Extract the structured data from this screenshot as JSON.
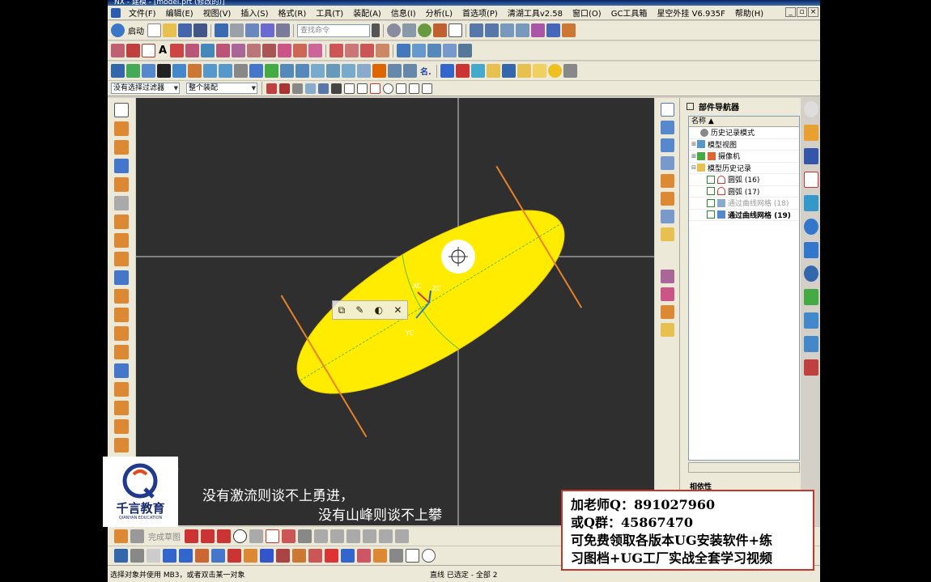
{
  "titlebar": {
    "text": "NX - 建模 - [model.prt (修改的)]"
  },
  "menu": {
    "items": [
      "文件(F)",
      "编辑(E)",
      "视图(V)",
      "插入(S)",
      "格式(R)",
      "工具(T)",
      "装配(A)",
      "信息(I)",
      "分析(L)",
      "首选项(P)",
      "清湖工具v2.58",
      "窗口(O)",
      "GC工具箱",
      "星空外挂 V6.935F",
      "帮助(H)"
    ]
  },
  "toolbar1": {
    "start_label": "启动",
    "search_placeholder": "查找命令"
  },
  "filter": {
    "selection_filter": "没有选择过滤器",
    "assembly_scope": "整个装配"
  },
  "navigator": {
    "title": "部件导航器",
    "column_header": "名称",
    "items": [
      {
        "label": "历史记录模式",
        "indent": 1
      },
      {
        "label": "模型视图",
        "indent": 0
      },
      {
        "label": "摄像机",
        "indent": 0
      },
      {
        "label": "模型历史记录",
        "indent": 0
      },
      {
        "label": "圆弧 (16)",
        "indent": 2
      },
      {
        "label": "圆弧 (17)",
        "indent": 2
      },
      {
        "label": "通过曲线网格 (18)",
        "indent": 2
      },
      {
        "label": "通过曲线网格 (19)",
        "indent": 2
      }
    ],
    "dependents_label": "相依性"
  },
  "bottom_toolbar": {
    "finish_sketch_label": "完成草图"
  },
  "status": {
    "prompt": "选择对象并使用 MB3，或者双击某一对象",
    "selection": "直线 已选定 - 全部 2"
  },
  "viewport": {
    "axis_labels": {
      "xc": "XC",
      "yc": "YC",
      "zc": "ZC"
    }
  },
  "overlay": {
    "logo_cn": "千言教育",
    "logo_en": "QIANYAN EDUCATION",
    "subtitle_line1": "没有激流则谈不上勇进，",
    "subtitle_line2": "没有山峰则谈不上攀",
    "ad_lines": [
      "加老师Q：891027960",
      "或Q群：45867470",
      "可免费领取各版本UG安装软件+练",
      "习图档+UG工厂实战全套学习视频"
    ]
  },
  "colors": {
    "surface": "#ffec00",
    "curve": "#e8822a",
    "crosshair": "#d0d0d0",
    "viewport_bg": "#2f2f2f",
    "ad_border": "#c0392b"
  }
}
